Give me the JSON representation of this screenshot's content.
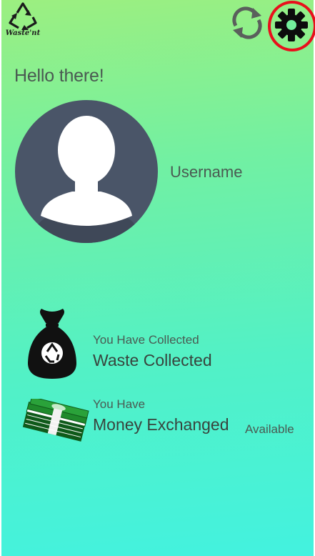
{
  "app": {
    "logo_text": "Waste'nt",
    "logo_icon": "recycle-icon"
  },
  "header": {
    "refresh_icon": "refresh-icon",
    "settings_icon": "gear-icon",
    "settings_highlight_color": "#e8101c"
  },
  "profile": {
    "greeting": "Hello there!",
    "avatar_icon": "user-silhouette-icon",
    "username": "Username"
  },
  "stats": {
    "waste": {
      "icon": "recycle-bag-icon",
      "caption": "You Have Collected",
      "value": "Waste Collected"
    },
    "money": {
      "icon": "money-stack-icon",
      "caption": "You Have",
      "value": "Money Exchanged",
      "suffix": "Available"
    }
  },
  "colors": {
    "gradient_top": "#9cef80",
    "gradient_bottom": "#43f2df",
    "avatar_bg": "#4a5568",
    "text": "#4a5a52"
  }
}
